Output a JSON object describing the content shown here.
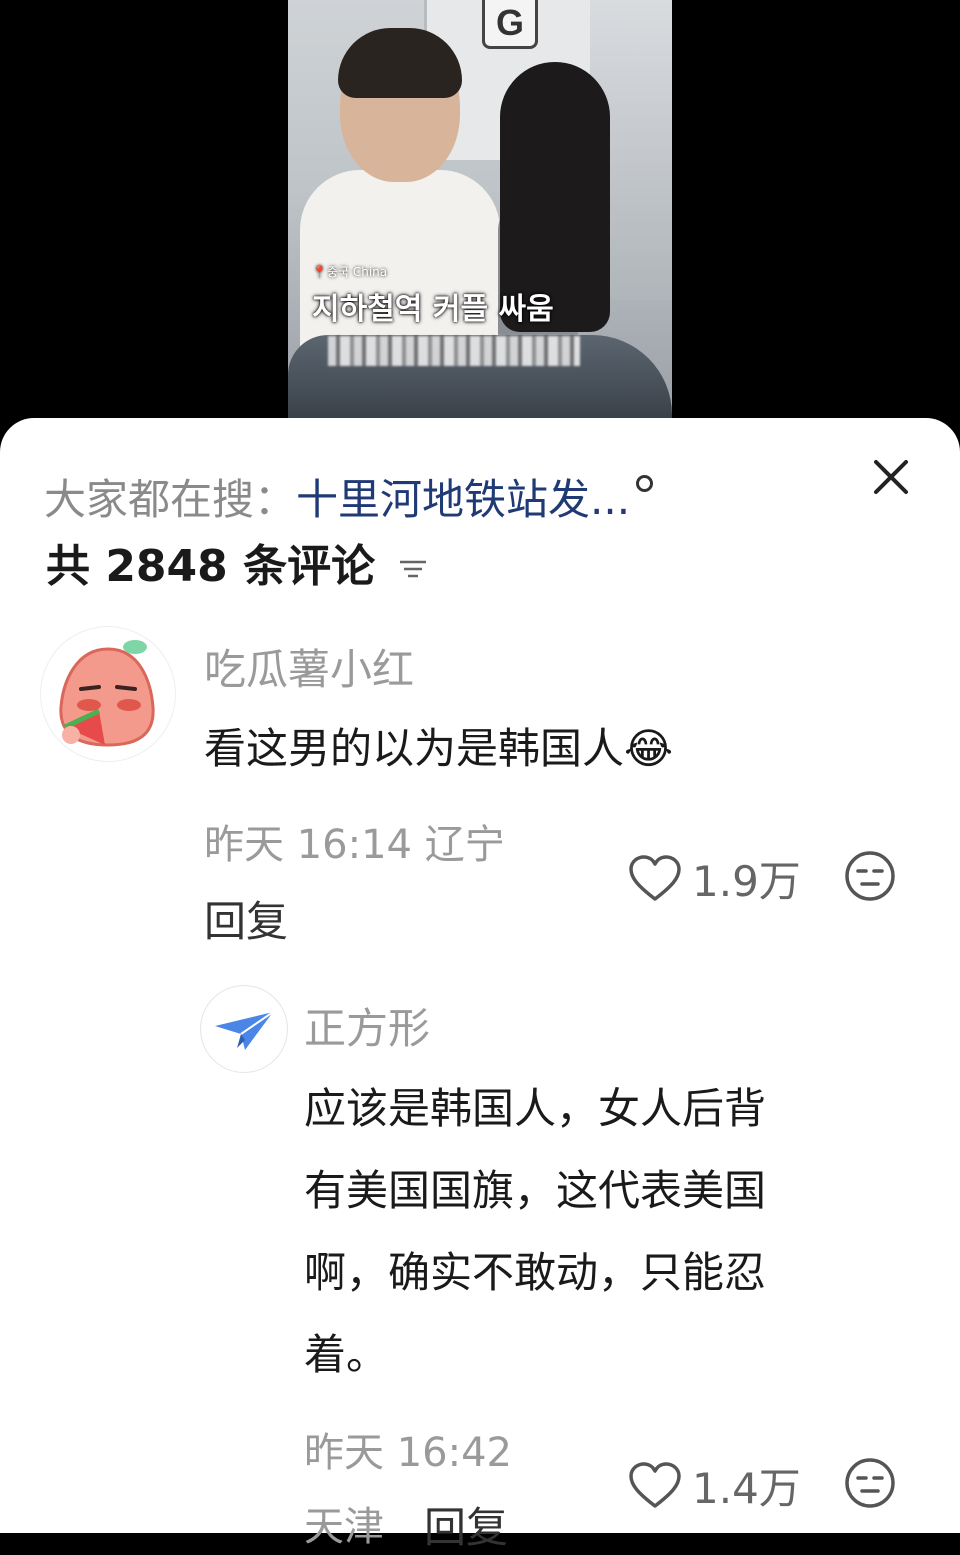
{
  "video": {
    "location_tag": "중국 China",
    "caption": "지하철역 커플 싸움",
    "sign_letter": "G"
  },
  "search": {
    "prefix": "大家都在搜：",
    "query": "十里河地铁站发..."
  },
  "comments_header": {
    "count_text": "共 2848 条评论"
  },
  "comments": [
    {
      "username": "吃瓜薯小红",
      "text": "看这男的以为是韩国人",
      "emoji": "😂",
      "time": "昨天 16:14",
      "region": "辽宁",
      "reply_label": "回复",
      "likes": "1.9万"
    }
  ],
  "replies": [
    {
      "username": "正方形",
      "text_lines": [
        "应该是韩国人，女人后背",
        "有美国国旗，这代表美国",
        "啊，确实不敢动，只能忍",
        "着。"
      ],
      "time": "昨天 16:42",
      "region": "天津",
      "reply_label": "回复",
      "likes": "1.4万"
    }
  ],
  "colors": {
    "query": "#1f3a74",
    "muted": "#9a9a9a",
    "text": "#1a1a1a"
  }
}
